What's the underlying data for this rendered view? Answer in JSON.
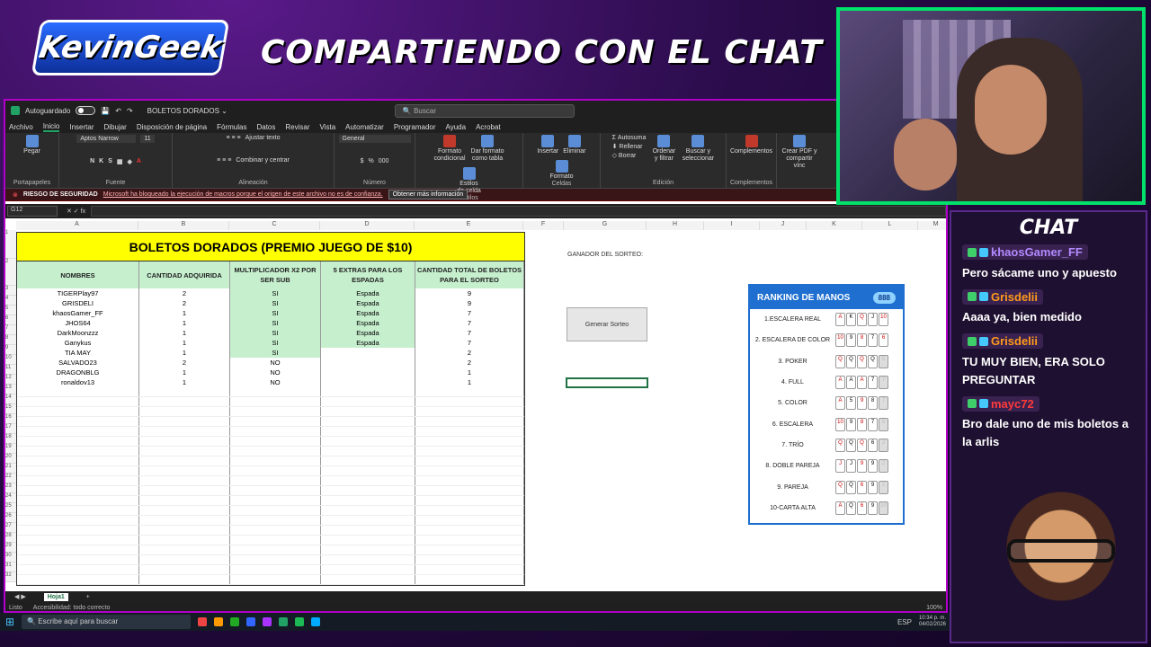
{
  "overlay": {
    "logo": "KevinGeek",
    "headline": "COMPARTIENDO CON EL CHAT"
  },
  "excel": {
    "autosave_label": "Autoguardado",
    "file_name": "BOLETOS DORADOS ⌄",
    "search_placeholder": "Buscar",
    "menus": [
      "Archivo",
      "Inicio",
      "Insertar",
      "Dibujar",
      "Disposición de página",
      "Fórmulas",
      "Datos",
      "Revisar",
      "Vista",
      "Automatizar",
      "Programador",
      "Ayuda",
      "Acrobat"
    ],
    "ribbon": {
      "paste": "Pegar",
      "clipboard_group": "Portapapeles",
      "font_name": "Aptos Narrow",
      "font_size": "11",
      "font_group": "Fuente",
      "wrap_text": "Ajustar texto",
      "merge_center": "Combinar y centrar",
      "alignment_group": "Alineación",
      "number_format": "General",
      "number_group": "Número",
      "cond_format": "Formato condicional",
      "format_table": "Dar formato como tabla",
      "cell_styles": "Estilos de celda",
      "styles_group": "Estilos",
      "insert": "Insertar",
      "delete": "Eliminar",
      "format": "Formato",
      "cells_group": "Celdas",
      "autosum": "Autosuma",
      "fill": "Rellenar",
      "clear": "Borrar",
      "sort_filter": "Ordenar y filtrar",
      "find_select": "Buscar y seleccionar",
      "editing_group": "Edición",
      "addins": "Complementos",
      "addins_group": "Complementos",
      "create_pdf": "Crear PDF y compartir vínc"
    },
    "security": {
      "label": "RIESGO DE SEGURIDAD",
      "message": "Microsoft ha bloqueado la ejecución de macros porque el origen de este archivo no es de confianza.",
      "button": "Obtener más información"
    },
    "name_box": "G12",
    "columns": [
      "A",
      "B",
      "C",
      "D",
      "E",
      "F",
      "G",
      "H",
      "I",
      "J",
      "K",
      "L",
      "M"
    ],
    "table": {
      "banner": "BOLETOS DORADOS (PREMIO JUEGO DE $10)",
      "headers": [
        "NOMBRES",
        "CANTIDAD ADQUIRIDA",
        "MULTIPLICADOR X2 POR SER SUB",
        "5 EXTRAS PARA LOS ESPADAS",
        "CANTIDAD TOTAL DE BOLETOS PARA EL SORTEO"
      ],
      "rows": [
        [
          "TIGERPlay97",
          "2",
          "SI",
          "Espada",
          "9"
        ],
        [
          "GRISDELI",
          "2",
          "SI",
          "Espada",
          "9"
        ],
        [
          "khaosGamer_FF",
          "1",
          "SI",
          "Espada",
          "7"
        ],
        [
          "JHOS64",
          "1",
          "SI",
          "Espada",
          "7"
        ],
        [
          "DarkMoonzzz",
          "1",
          "SI",
          "Espada",
          "7"
        ],
        [
          "Ganykus",
          "1",
          "SI",
          "Espada",
          "7"
        ],
        [
          "TIA MAY",
          "1",
          "SI",
          "",
          "2"
        ],
        [
          "SALVADO23",
          "2",
          "NO",
          "",
          "2"
        ],
        [
          "DRAGONBLG",
          "1",
          "NO",
          "",
          "1"
        ],
        [
          "ronaldov13",
          "1",
          "NO",
          "",
          "1"
        ]
      ]
    },
    "winner_label": "GANADOR DEL SORTEO:",
    "generate_button": "Generar Sorteo",
    "ranking": {
      "title": "RANKING DE MANOS",
      "badge": "888",
      "hands": [
        "1.ESCALERA REAL",
        "2. ESCALERA DE COLOR",
        "3. POKER",
        "4. FULL",
        "5. COLOR",
        "6. ESCALERA",
        "7. TRÍO",
        "8. DOBLE PAREJA",
        "9. PAREJA",
        "10-CARTA ALTA"
      ]
    },
    "sheet_tab": "Hoja1",
    "status_ready": "Listo",
    "status_access": "Accesibilidad: todo correcto",
    "zoom": "100%"
  },
  "taskbar": {
    "search": "Escribe aquí para buscar",
    "time": "10:34 p. m.",
    "date": "04/02/2026",
    "lang": "ESP"
  },
  "chat": {
    "title": "CHAT",
    "messages": [
      {
        "user": "khaosGamer_FF",
        "color": "#b08aff",
        "text": "Pero sácame uno y apuesto"
      },
      {
        "user": "Grisdelii",
        "color": "#ff9a1a",
        "text": "Aaaa ya, bien medido"
      },
      {
        "user": "Grisdelii",
        "color": "#ff9a1a",
        "text": "TU MUY BIEN, ERA SOLO PREGUNTAR"
      },
      {
        "user": "mayc72",
        "color": "#ff3a3a",
        "text": "Bro dale uno de mis boletos a la arlis"
      }
    ]
  }
}
